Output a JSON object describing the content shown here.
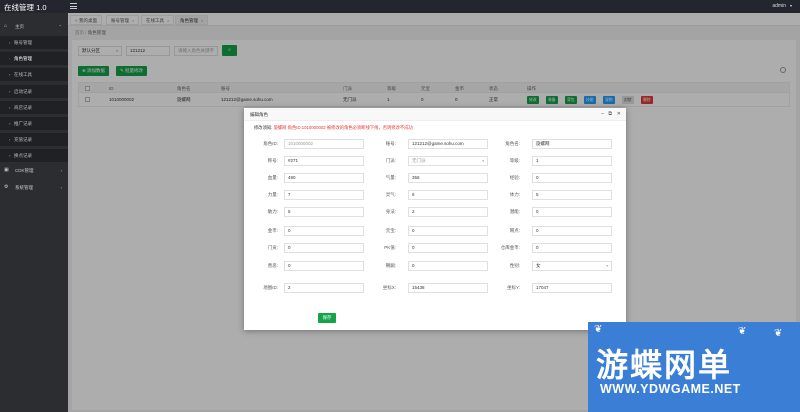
{
  "app": {
    "title": "在线管理 1.0",
    "user": "admin"
  },
  "sidebar": {
    "home": "主页",
    "items": [
      {
        "label": "账号管理"
      },
      {
        "label": "角色管理"
      },
      {
        "label": "在线工具"
      },
      {
        "label": "启动记录"
      },
      {
        "label": "商店记录"
      },
      {
        "label": "推广记录"
      },
      {
        "label": "充值记录"
      },
      {
        "label": "换点记录"
      }
    ],
    "cdk": "CDK管理",
    "system": "系统管理"
  },
  "tabs": [
    {
      "label": "我的桌面"
    },
    {
      "label": "账号管理"
    },
    {
      "label": "在线工具"
    },
    {
      "label": "角色管理"
    }
  ],
  "breadcrumb": {
    "root": "首页",
    "sep": "/",
    "current": "角色管理"
  },
  "search": {
    "server": "默认分区",
    "account": "121212",
    "role_placeholder": "请输入角色关键字"
  },
  "actions": {
    "add": "添加数据",
    "batch": "批量修改"
  },
  "table": {
    "headers": [
      "ID",
      "角色名",
      "账号",
      "门派",
      "等级",
      "元宝",
      "金币",
      "状态",
      "操作"
    ],
    "rows": [
      {
        "id": "1010000002",
        "name": "旋螺网",
        "account": "121212@game.sohu.com",
        "sect": "无门派",
        "level": "1",
        "yuanbao": "0",
        "gold": "0",
        "status": "正常"
      }
    ],
    "ops": [
      {
        "label": "修改",
        "color": "#16a34a"
      },
      {
        "label": "装备",
        "color": "#16a34a"
      },
      {
        "label": "背包",
        "color": "#16a34a"
      },
      {
        "label": "技能",
        "color": "#1e9fff"
      },
      {
        "label": "宠物",
        "color": "#1e9fff"
      },
      {
        "label": "封禁",
        "color": "#e0e0e0"
      },
      {
        "label": "删除",
        "color": "#e53935"
      }
    ]
  },
  "modal": {
    "title": "编辑角色",
    "notice_key": "修改须知:",
    "notice": "旋螺网 角色ID:1010000002 被修改的角色必须断线下线，否则修改不成功",
    "fields": [
      {
        "label": "角色ID:",
        "value": "1010000002",
        "disabled": true
      },
      {
        "label": "账号:",
        "value": "121212@game.sohu.com"
      },
      {
        "label": "角色名:",
        "value": "旋螺网"
      },
      {
        "label": "称号:",
        "value": "#271"
      },
      {
        "label": "门派:",
        "value": "无门派",
        "select": true,
        "disabled": true
      },
      {
        "label": "等级:",
        "value": "1"
      },
      {
        "label": "血量:",
        "value": "490"
      },
      {
        "label": "气量:",
        "value": "356"
      },
      {
        "label": "经验:",
        "value": "0"
      },
      {
        "label": "力量:",
        "value": "7"
      },
      {
        "label": "灵气:",
        "value": "6"
      },
      {
        "label": "体力:",
        "value": "5"
      },
      {
        "label": "敏力:",
        "value": "5"
      },
      {
        "label": "身法:",
        "value": "2"
      },
      {
        "label": "潜能:",
        "value": "0"
      },
      {
        "label": "金币:",
        "value": "0"
      },
      {
        "label": "元宝:",
        "value": "0"
      },
      {
        "label": "网点:",
        "value": "0"
      },
      {
        "label": "门贡:",
        "value": "0"
      },
      {
        "label": "PK值:",
        "value": "0"
      },
      {
        "label": "仓库金币:",
        "value": "0"
      },
      {
        "label": "善恶:",
        "value": "0"
      },
      {
        "label": "朝嗣:",
        "value": "0"
      },
      {
        "label": "性别:",
        "value": "女",
        "select": true
      },
      {
        "label": "地图ID:",
        "value": "2"
      },
      {
        "label": "坐标X:",
        "value": "15438"
      },
      {
        "label": "坐标Y:",
        "value": "17047"
      }
    ],
    "save": "保存"
  },
  "watermark": {
    "big": "游蝶网单",
    "small": "WWW.YDWGAME.NET"
  }
}
